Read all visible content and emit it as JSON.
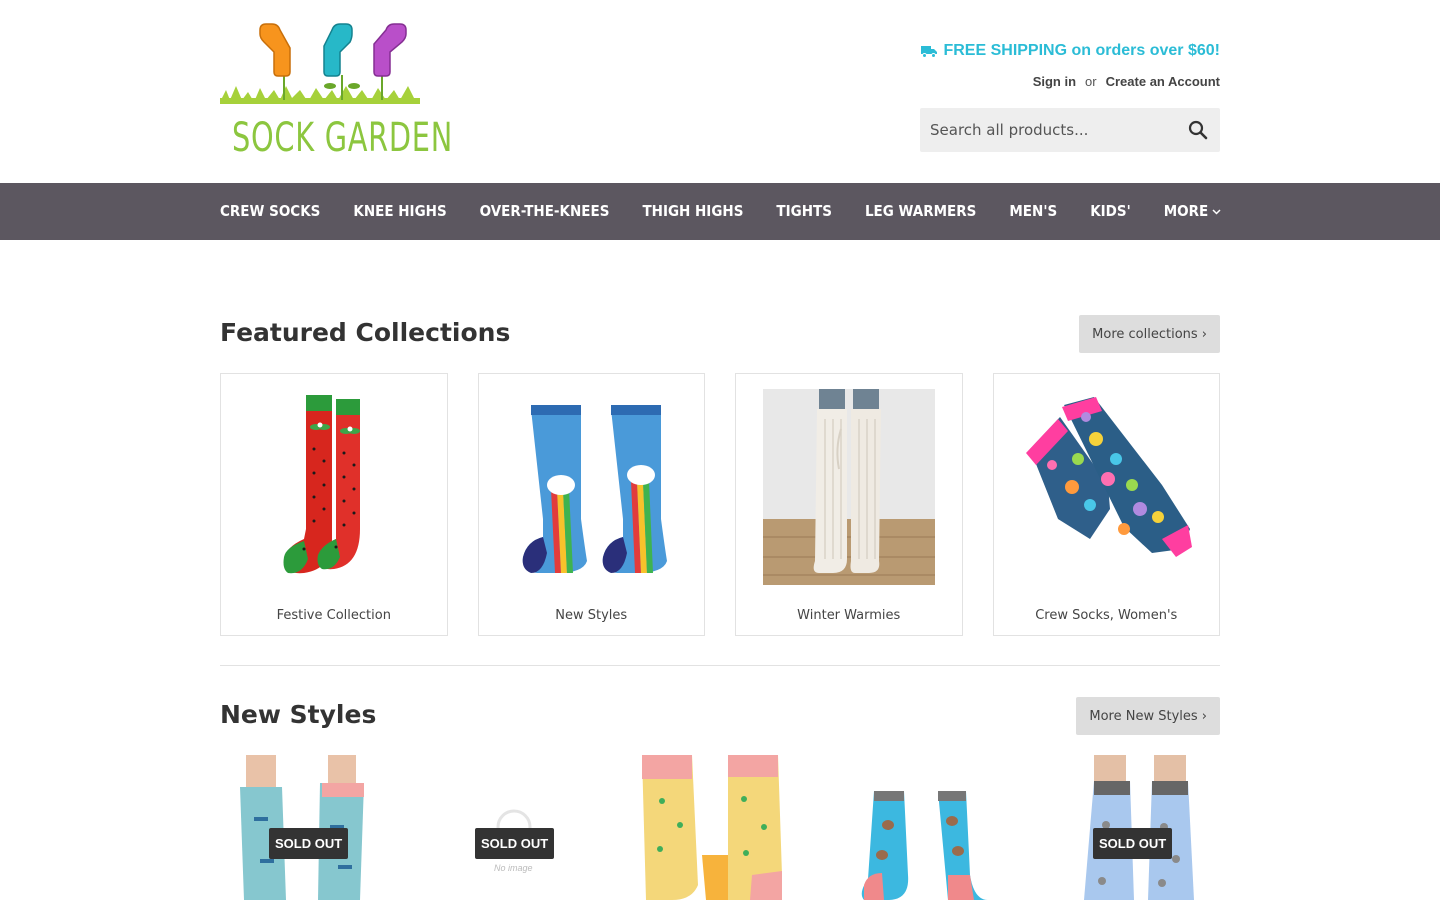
{
  "header": {
    "logo_text": "SOCK GARDEN",
    "shipping": "FREE SHIPPING on orders over $60!",
    "sign_in": "Sign in",
    "or": "or",
    "create_account": "Create an Account",
    "search_placeholder": "Search all products..."
  },
  "nav": {
    "items": [
      "CREW SOCKS",
      "KNEE HIGHS",
      "OVER-THE-KNEES",
      "THIGH HIGHS",
      "TIGHTS",
      "LEG WARMERS",
      "MEN'S",
      "KIDS'"
    ],
    "more": "MORE"
  },
  "featured": {
    "title": "Featured Collections",
    "more_label": "More collections ›",
    "collections": [
      {
        "label": "Festive Collection"
      },
      {
        "label": "New Styles"
      },
      {
        "label": "Winter Warmies"
      },
      {
        "label": "Crew Socks, Women's"
      }
    ]
  },
  "new_styles": {
    "title": "New Styles",
    "more_label": "More New Styles ›",
    "sold_out": "SOLD OUT",
    "no_image": "No image"
  },
  "colors": {
    "nav_bg": "#5c5760",
    "shipping": "#2bbcd6",
    "logo_green": "#8cc63f",
    "button_bg": "#dddddd"
  }
}
